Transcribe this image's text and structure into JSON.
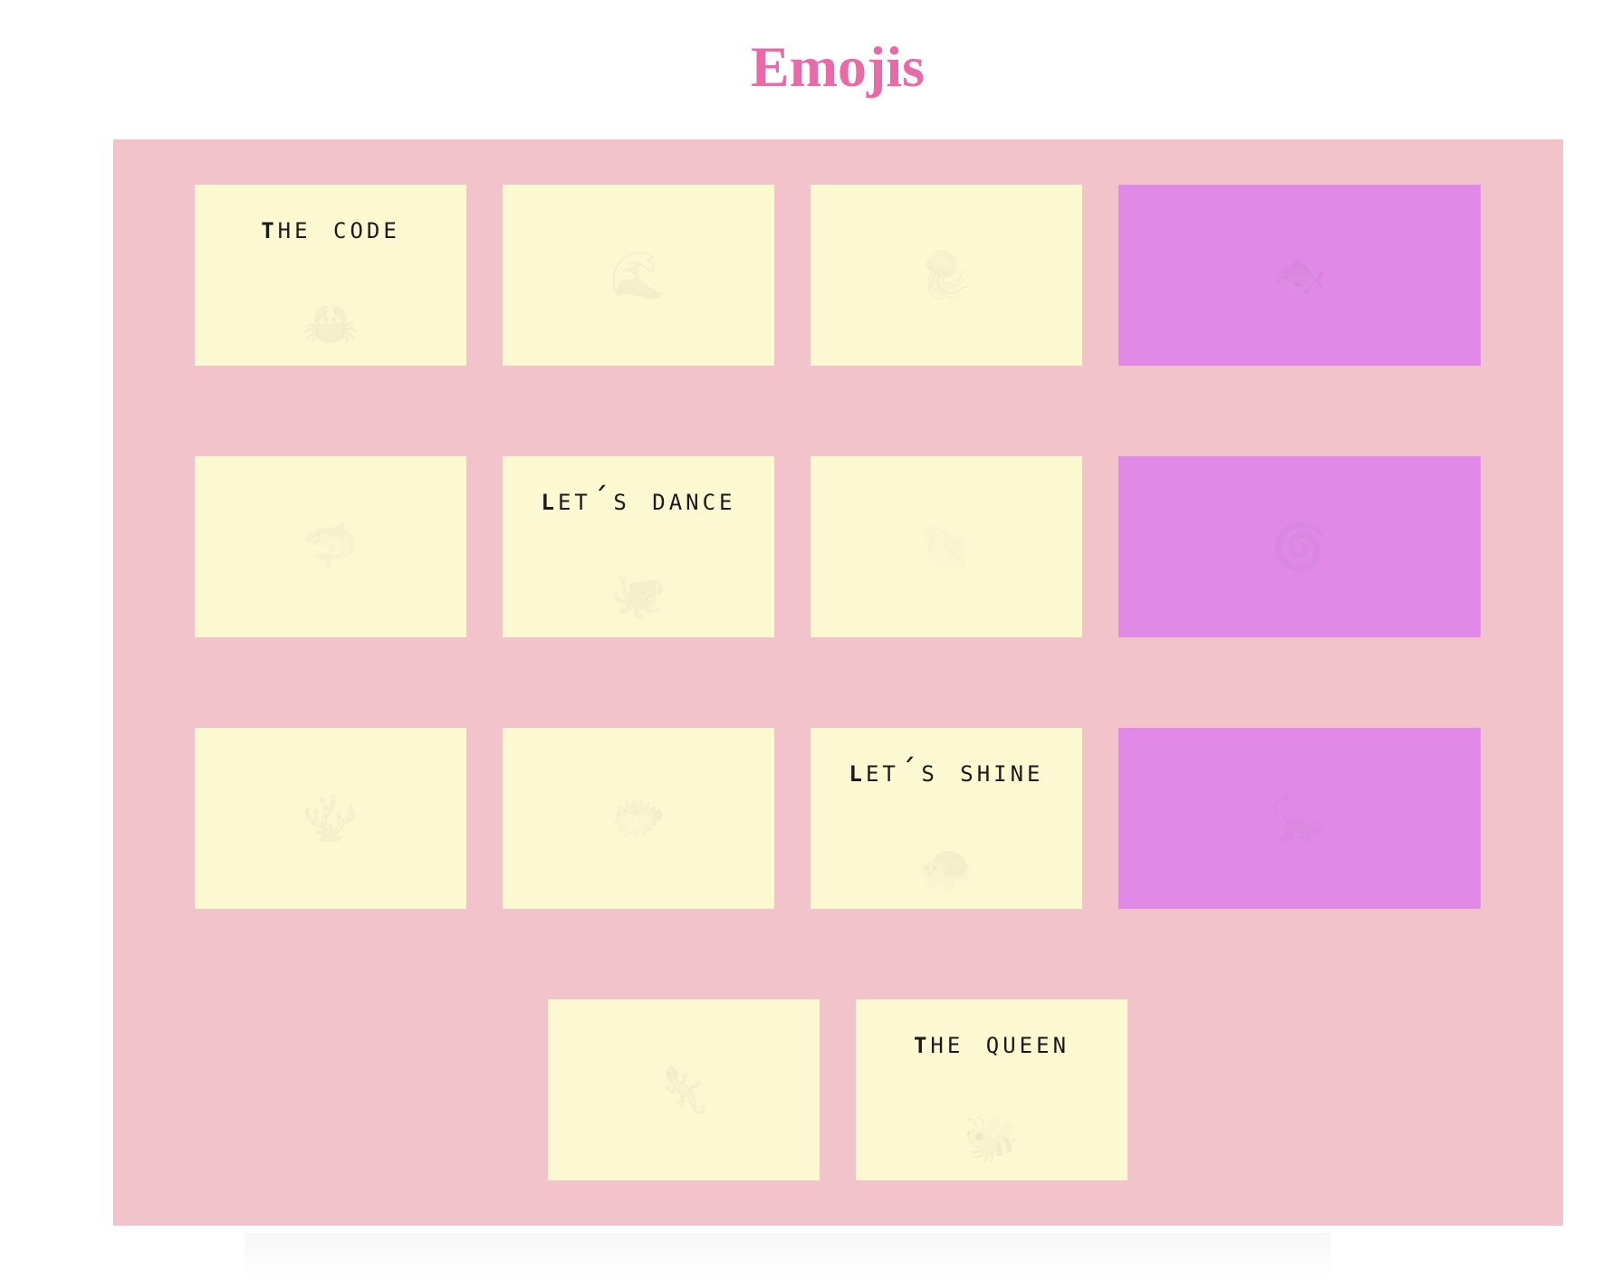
{
  "page": {
    "title": "Emojis",
    "title_color": "#e96aa8",
    "board_color": "#f3c3cb",
    "card_color": "#fcf8d1",
    "wide_card_color": "#e089e7"
  },
  "cards": [
    {
      "label": "The Code",
      "emoji": "🦀",
      "icon": "crab-icon"
    },
    {
      "label": "",
      "emoji": "🌊",
      "icon": "wave-icon"
    },
    {
      "label": "",
      "emoji": "🪼",
      "icon": "jellyfish-icon"
    },
    {
      "label": "",
      "emoji": "🐟",
      "icon": "fish-icon"
    },
    {
      "label": "",
      "emoji": "🦈",
      "icon": "shark-icon"
    },
    {
      "label": "Let´s Dance",
      "emoji": "🐙",
      "icon": "octopus-icon"
    },
    {
      "label": "",
      "emoji": "🐚",
      "icon": "shell-icon"
    },
    {
      "label": "",
      "emoji": "🌀",
      "icon": "spiral-icon"
    },
    {
      "label": "",
      "emoji": "🪸",
      "icon": "coral-icon"
    },
    {
      "label": "",
      "emoji": "🐡",
      "icon": "blowfish-icon"
    },
    {
      "label": "Let´s Shine",
      "emoji": "🐢",
      "icon": "turtle-icon"
    },
    {
      "label": "",
      "emoji": "🦕",
      "icon": "dinosaur-icon"
    },
    {
      "label": "",
      "emoji": "🦎",
      "icon": "lizard-icon"
    },
    {
      "label": "The Queen",
      "emoji": "🐝",
      "icon": "bee-icon"
    }
  ]
}
